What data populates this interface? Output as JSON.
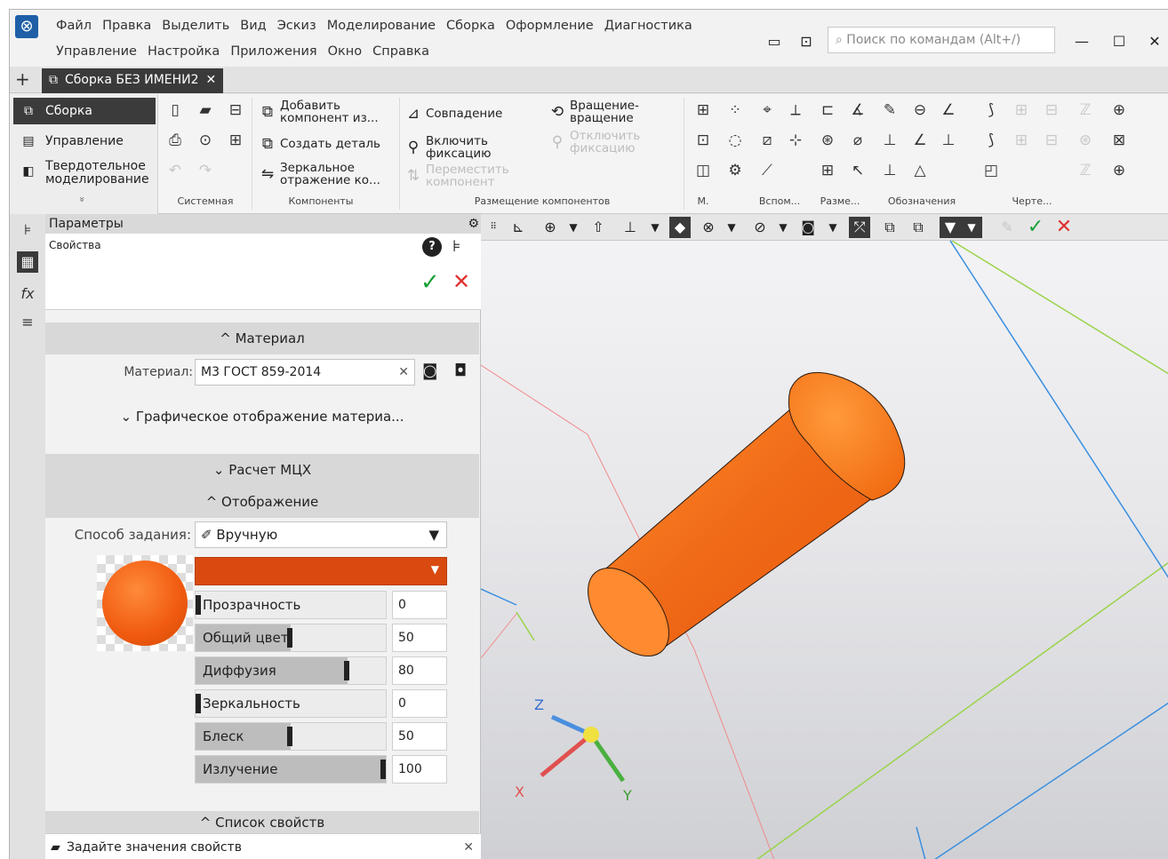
{
  "menu": {
    "row1": [
      "Файл",
      "Правка",
      "Выделить",
      "Вид",
      "Эскиз",
      "Моделирование",
      "Сборка",
      "Оформление",
      "Диагностика"
    ],
    "row2": [
      "Управление",
      "Настройка",
      "Приложения",
      "Окно",
      "Справка"
    ]
  },
  "search": {
    "placeholder": "Поиск по командам (Alt+/)"
  },
  "window_controls": {
    "minimize": "—",
    "maximize": "☐",
    "close": "✕"
  },
  "tab": {
    "title": "Сборка БЕЗ ИМЕНИ2",
    "close": "✕",
    "add": "+"
  },
  "ribbon": {
    "modes": [
      {
        "label": "Сборка"
      },
      {
        "label": "Управление"
      },
      {
        "label": "Твердотельное моделирование"
      }
    ],
    "expand": "»",
    "groups": {
      "system": "Системная",
      "components": "Компоненты",
      "placement": "Размещение компонентов",
      "m": "М.",
      "aux": "Вспом...",
      "dim": "Разме...",
      "design": "Обозначения",
      "draw": "Черте..."
    },
    "buttons": {
      "add_component": "Добавить компонент из...",
      "create_part": "Создать деталь",
      "mirror": "Зеркальное отражение ко...",
      "coincidence": "Совпадение",
      "fix": "Включить фиксацию",
      "move": "Переместить компонент",
      "rotation": "Вращение-вращение",
      "unfix": "Отключить фиксацию"
    }
  },
  "panel": {
    "title": "Параметры",
    "props_label": "Свойства",
    "material_section": "^ Материал",
    "material_label": "Материал:",
    "material_value": "М3 ГОСТ 859-2014",
    "graphic_display": "⌄ Графическое отображение материа...",
    "mcx_section": "⌄ Расчет МЦХ",
    "display_section": "^ Отображение",
    "method_label": "Способ задания:",
    "method_value": "Вручную",
    "color_hex": "#d94a10",
    "sliders": [
      {
        "label": "Прозрачность",
        "value": "0",
        "level": 0
      },
      {
        "label": "Общий цвет",
        "value": "50",
        "level": 50
      },
      {
        "label": "Диффузия",
        "value": "80",
        "level": 80
      },
      {
        "label": "Зеркальность",
        "value": "0",
        "level": 0
      },
      {
        "label": "Блеск",
        "value": "50",
        "level": 50
      },
      {
        "label": "Излучение",
        "value": "100",
        "level": 100
      }
    ],
    "props_list": "^ Список свойств",
    "status": "Задайте значения свойств"
  },
  "axes": {
    "x": "X",
    "y": "Y",
    "z": "Z"
  },
  "colors": {
    "accent": "#1f5fa8",
    "part": "#f26a1b",
    "ok": "#1aa038",
    "cancel": "#e03030"
  }
}
